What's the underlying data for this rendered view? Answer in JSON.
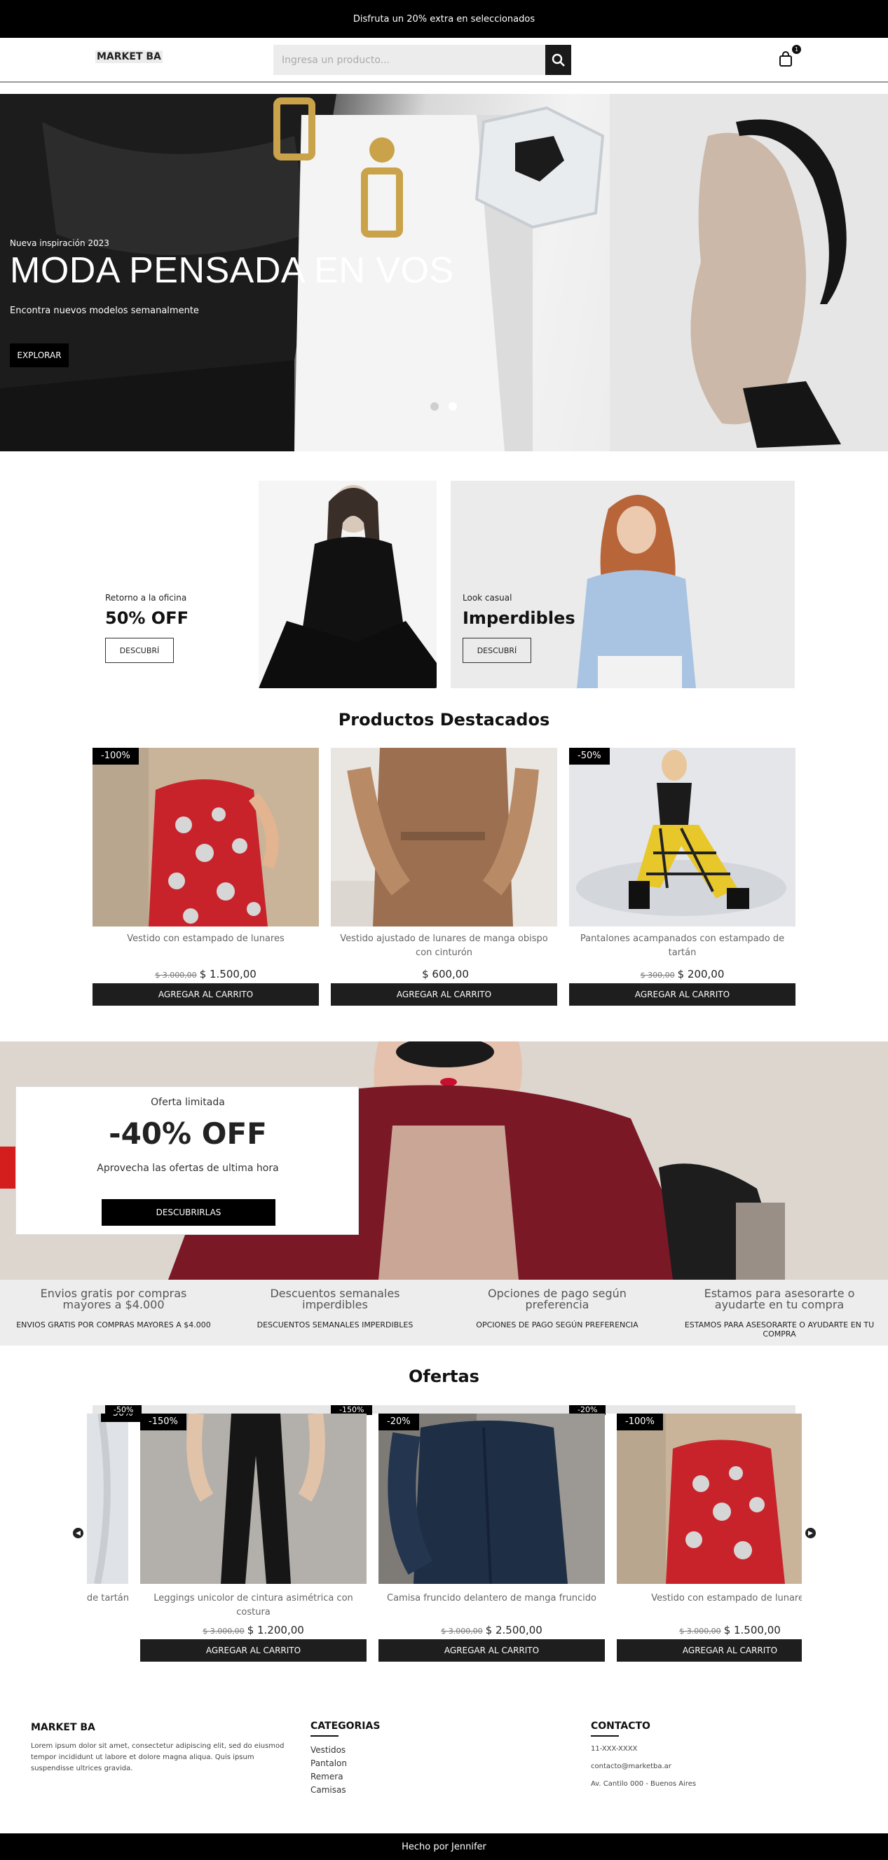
{
  "top_bar": {
    "text": "Disfruta un 20% extra en seleccionados"
  },
  "header": {
    "logo": "MARKET BA",
    "search_placeholder": "Ingresa un producto...",
    "cart_count": "1"
  },
  "hero": {
    "subtitle": "Nueva inspiración 2023",
    "title": "MODA PENSADA EN VOS",
    "description": "Encontra nuevos modelos semanalmente",
    "button": "EXPLORAR"
  },
  "promos": [
    {
      "small": "Retorno a la oficina",
      "big": "50% OFF",
      "button": "DESCUBRÍ"
    },
    {
      "small": "Look casual",
      "big": "Imperdibles",
      "button": "DESCUBRÍ"
    }
  ],
  "featured": {
    "title": "Productos Destacados",
    "products": [
      {
        "badge": "-100%",
        "name": "Vestido con estampado de lunares",
        "old_price": "$ 3.000,00",
        "price": "$ 1.500,00",
        "button": "AGREGAR AL CARRITO"
      },
      {
        "badge": "",
        "name": "Vestido ajustado de lunares de manga obispo con cinturón",
        "old_price": "",
        "price": "$ 600,00",
        "button": "AGREGAR AL CARRITO"
      },
      {
        "badge": "-50%",
        "name": "Pantalones acampanados con estampado de tartán",
        "old_price": "$ 300,00",
        "price": "$ 200,00",
        "button": "AGREGAR AL CARRITO"
      }
    ]
  },
  "offer_banner": {
    "small": "Oferta limitada",
    "big": "-40% OFF",
    "description": "Aprovecha las ofertas de ultima hora",
    "button": "DESCUBRIRLAS"
  },
  "features": [
    {
      "alt": "Envios gratis por compras mayores a $4.000",
      "label": "ENVIOS GRATIS POR COMPRAS MAYORES A $4.000"
    },
    {
      "alt": "Descuentos semanales imperdibles",
      "label": "DESCUENTOS SEMANALES IMPERDIBLES"
    },
    {
      "alt": "Opciones de pago según preferencia",
      "label": "OPCIONES DE PAGO SEGÚN PREFERENCIA"
    },
    {
      "alt": "Estamos para asesorarte o ayudarte en tu compra",
      "label": "ESTAMOS PARA ASESORARTE O AYUDARTE EN TU COMPRA"
    }
  ],
  "offers": {
    "title": "Ofertas",
    "ghost_badges": [
      "-50%",
      "-150%",
      "-20%",
      "-100%"
    ],
    "products": [
      {
        "badge": "-50%",
        "name": "de tartán",
        "old_price": "",
        "price": "",
        "button": ""
      },
      {
        "badge": "-150%",
        "name": "Leggings unicolor de cintura asimétrica con costura",
        "old_price": "$ 3.000,00",
        "price": "$ 1.200,00",
        "button": "AGREGAR AL CARRITO"
      },
      {
        "badge": "-20%",
        "name": "Camisa fruncido delantero de manga fruncido",
        "old_price": "$ 3.000,00",
        "price": "$ 2.500,00",
        "button": "AGREGAR AL CARRITO"
      },
      {
        "badge": "-100%",
        "name": "Vestido con estampado de lunares",
        "old_price": "$ 3.000,00",
        "price": "$ 1.500,00",
        "button": "AGREGAR AL CARRITO"
      }
    ]
  },
  "footer": {
    "brand": "MARKET BA",
    "about": "Lorem ipsum dolor sit amet, consectetur adipiscing elit, sed do eiusmod tempor incididunt ut labore et dolore magna aliqua. Quis ipsum suspendisse ultrices gravida.",
    "categories_title": "CATEGORIAS",
    "categories": [
      "Vestidos",
      "Pantalon",
      "Remera",
      "Camisas"
    ],
    "contact_title": "CONTACTO",
    "contact": [
      "11-XXX-XXXX",
      "contacto@marketba.ar",
      "Av. Cantilo 000 - Buenos Aires"
    ]
  },
  "bottom_bar": {
    "text": "Hecho por Jennifer"
  },
  "colors": {
    "primary": "#000000",
    "button_dark": "#1e1e1e",
    "feature_bg": "#ededed",
    "banner_red": "#8b1e2c"
  }
}
